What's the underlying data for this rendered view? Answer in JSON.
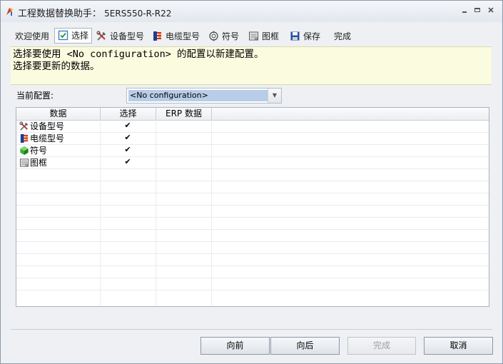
{
  "window": {
    "title": "工程数据替换助手：",
    "project": "5ERS550-R-R22",
    "controls": [
      "minimize",
      "maximize",
      "close"
    ]
  },
  "toolbar": {
    "items": [
      {
        "label": "欢迎使用",
        "icon": ""
      },
      {
        "label": "选择",
        "icon": "checkbox-icon",
        "active": true
      },
      {
        "label": "设备型号",
        "icon": "tools-icon"
      },
      {
        "label": "电缆型号",
        "icon": "cable-icon"
      },
      {
        "label": "符号",
        "icon": "symbol-icon"
      },
      {
        "label": "图框",
        "icon": "frame-icon"
      },
      {
        "label": "保存",
        "icon": "save-icon"
      },
      {
        "label": "完成",
        "icon": ""
      }
    ]
  },
  "info": {
    "line1": "选择要使用 <No configuration> 的配置以新建配置。",
    "line2": "选择要更新的数据。"
  },
  "config": {
    "label": "当前配置:",
    "value": "<No configuration>"
  },
  "grid": {
    "columns": [
      "数据",
      "选择",
      "ERP 数据"
    ],
    "rows": [
      {
        "name": "设备型号",
        "icon": "tools-icon",
        "checked": true
      },
      {
        "name": "电缆型号",
        "icon": "cable-icon",
        "checked": true
      },
      {
        "name": "符号",
        "icon": "symbol-icon",
        "checked": true
      },
      {
        "name": "图框",
        "icon": "frame-icon",
        "checked": true
      }
    ]
  },
  "buttons": {
    "back": "向前",
    "next": "向后",
    "finish": "完成",
    "cancel": "取消"
  },
  "colors": {
    "info_bg": "#fbfbe0",
    "selection": "#b7cde8"
  }
}
